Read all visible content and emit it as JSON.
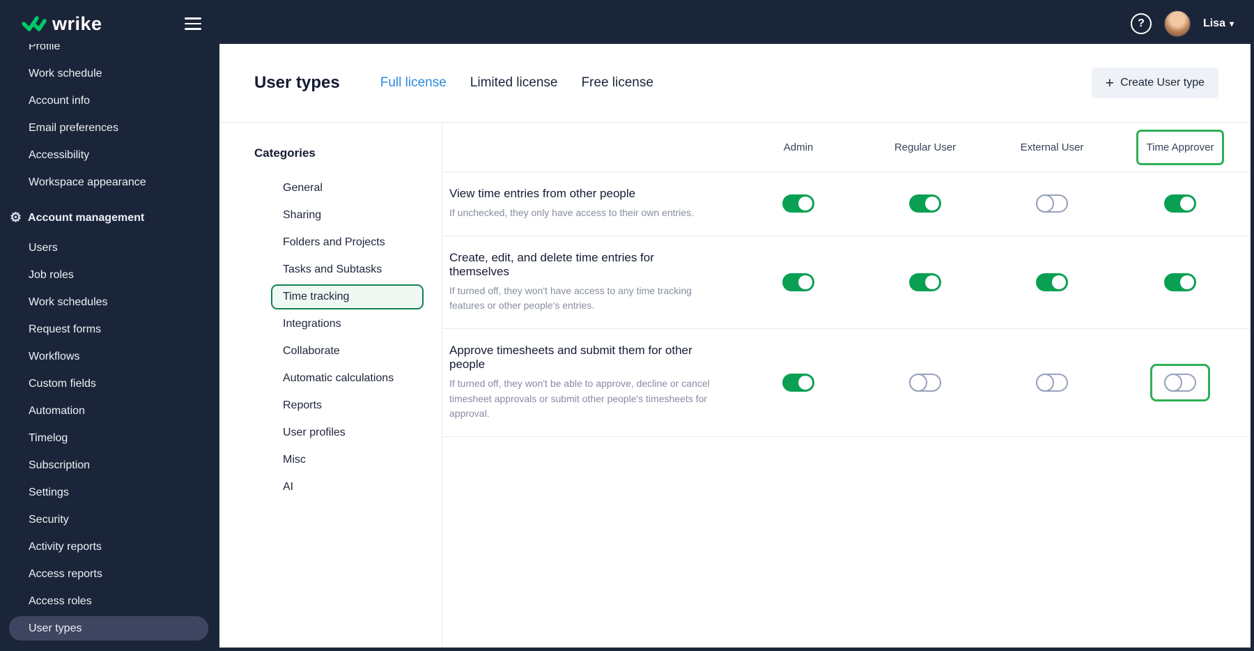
{
  "topbar": {
    "brand": "wrike",
    "user_name": "Lisa"
  },
  "icons": {
    "gear": "⚙",
    "question": "?",
    "chevron_down": "▾",
    "plus": "+"
  },
  "colors": {
    "navy": "#1b2539",
    "brand_green": "#00c968",
    "toggle_on_green": "#0aa053",
    "highlight_green": "#2cb053",
    "active_tab_blue": "#2a8ae2",
    "selected_category_border": "#11804f",
    "selected_category_bg": "#f0f8f3"
  },
  "sidebar": {
    "items": [
      {
        "label": "Profile"
      },
      {
        "label": "Work schedule"
      },
      {
        "label": "Account info"
      },
      {
        "label": "Email preferences"
      },
      {
        "label": "Accessibility"
      },
      {
        "label": "Workspace appearance"
      },
      {
        "label": "Account management",
        "section": true
      },
      {
        "label": "Users"
      },
      {
        "label": "Job roles"
      },
      {
        "label": "Work schedules"
      },
      {
        "label": "Request forms"
      },
      {
        "label": "Workflows"
      },
      {
        "label": "Custom fields"
      },
      {
        "label": "Automation"
      },
      {
        "label": "Timelog"
      },
      {
        "label": "Subscription"
      },
      {
        "label": "Settings"
      },
      {
        "label": "Security"
      },
      {
        "label": "Activity reports"
      },
      {
        "label": "Access reports"
      },
      {
        "label": "Access roles"
      },
      {
        "label": "User types",
        "selected": true
      }
    ]
  },
  "header": {
    "title": "User types",
    "tabs": [
      {
        "label": "Full license",
        "active": true
      },
      {
        "label": "Limited license",
        "active": false
      },
      {
        "label": "Free license",
        "active": false
      }
    ],
    "create_button": "Create User type"
  },
  "categories": {
    "title": "Categories",
    "selected": "Time tracking",
    "items": [
      "General",
      "Sharing",
      "Folders and Projects",
      "Tasks and Subtasks",
      "Time tracking",
      "Integrations",
      "Collaborate",
      "Automatic calculations",
      "Reports",
      "User profiles",
      "Misc",
      "AI"
    ]
  },
  "table": {
    "columns": [
      "Admin",
      "Regular User",
      "External User",
      "Time Approver"
    ],
    "highlighted_column": "Time Approver",
    "rows": [
      {
        "title": "View time entries from other people",
        "description": "If unchecked, they only have access to their own entries.",
        "toggles": [
          true,
          true,
          false,
          true
        ]
      },
      {
        "title": "Create, edit, and delete time entries for themselves",
        "description": "If turned off, they won't have access to any time tracking features or other people's entries.",
        "toggles": [
          true,
          true,
          true,
          true
        ]
      },
      {
        "title": "Approve timesheets and submit them for other people",
        "description": "If turned off, they won't be able to approve, decline or cancel timesheet approvals or submit other people's timesheets for approval.",
        "toggles": [
          true,
          false,
          false,
          false
        ],
        "highlighted_toggle": 3
      }
    ]
  }
}
